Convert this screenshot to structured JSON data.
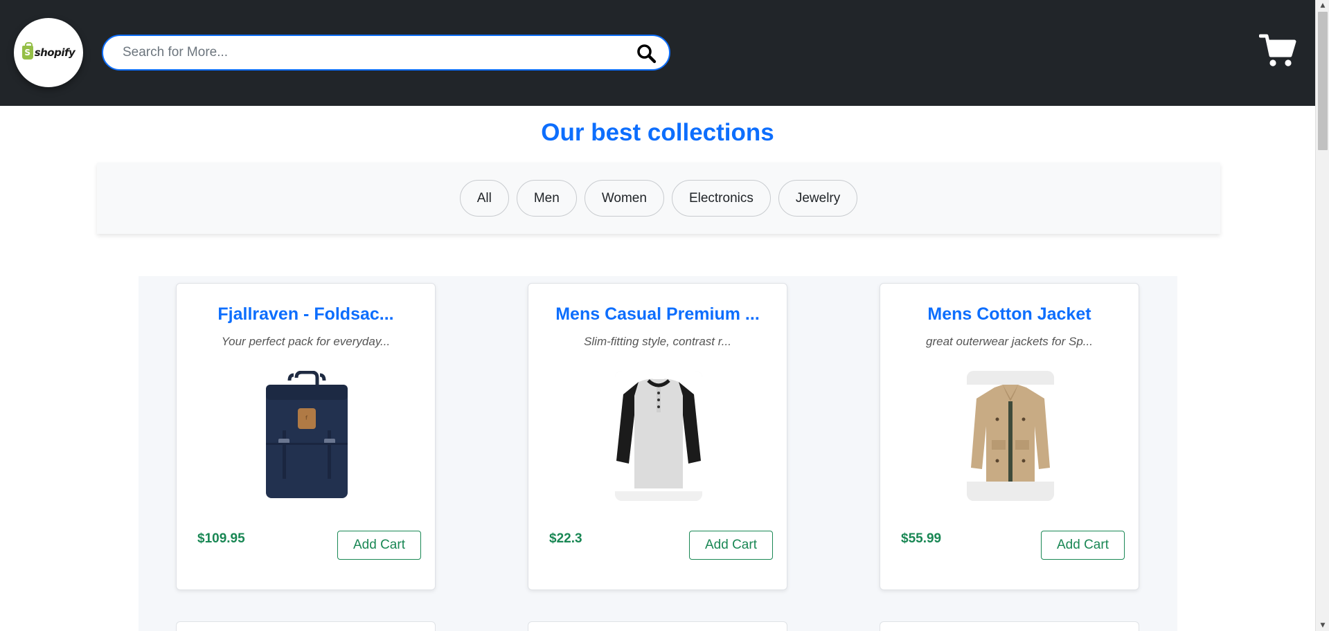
{
  "header": {
    "logo_text": "shopify",
    "search_placeholder": "Search for More...",
    "search_icon": "search-icon",
    "cart_icon": "cart-icon"
  },
  "section_title": "Our best collections",
  "filters": [
    "All",
    "Men",
    "Women",
    "Electronics",
    "Jewelry"
  ],
  "products": [
    {
      "title": "Fjallraven - Foldsac...",
      "description": "Your perfect pack for everyday...",
      "price": "$109.95",
      "button": "Add Cart",
      "image": "navy-backpack"
    },
    {
      "title": "Mens Casual Premium ...",
      "description": "Slim-fitting style, contrast r...",
      "price": "$22.3",
      "button": "Add Cart",
      "image": "raglan-tshirt"
    },
    {
      "title": "Mens Cotton Jacket",
      "description": "great outerwear jackets for Sp...",
      "price": "$55.99",
      "button": "Add Cart",
      "image": "khaki-jacket"
    }
  ],
  "colors": {
    "header_bg": "#212529",
    "accent": "#0d6efd",
    "price_green": "#198754",
    "brand_green": "#95bf47"
  }
}
